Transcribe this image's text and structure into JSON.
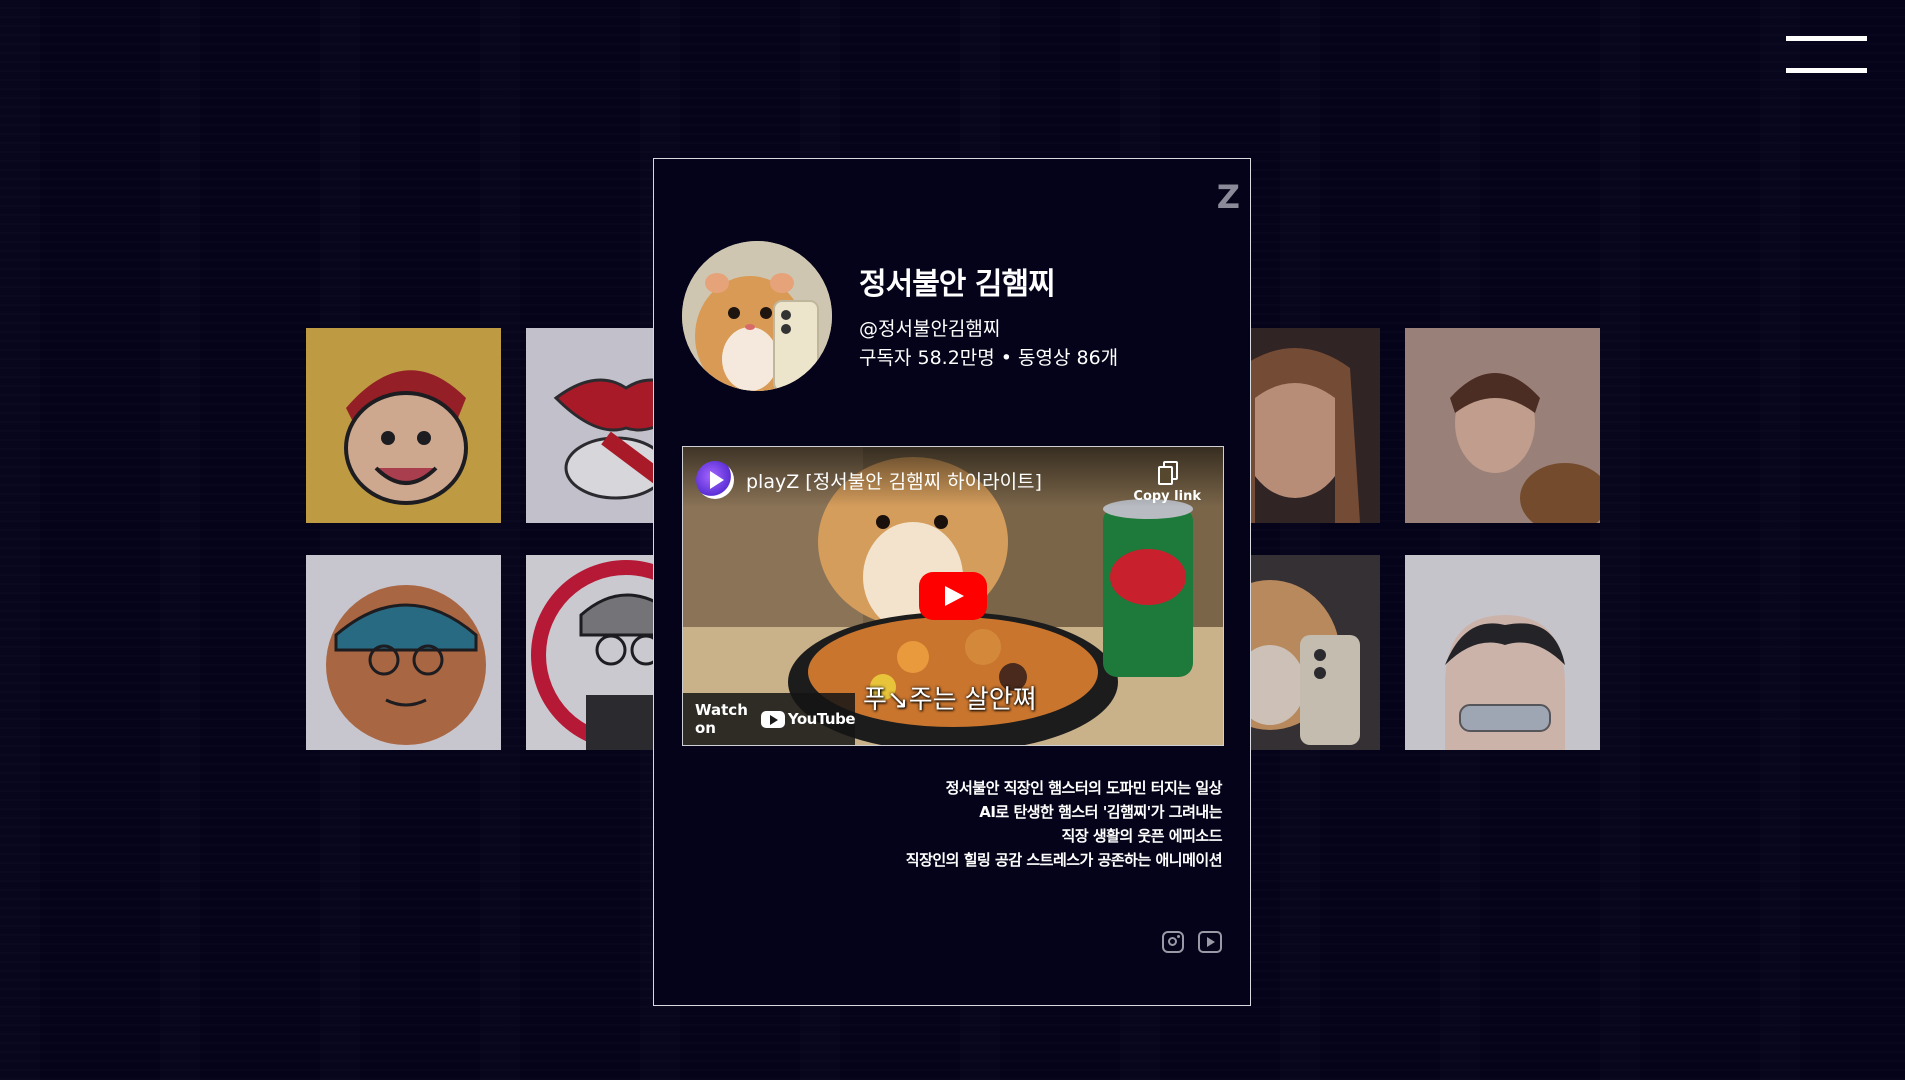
{
  "colors": {
    "background": "#04031a",
    "accent": "#ff0000",
    "text": "#ffffff",
    "muted": "#9a9aa6"
  },
  "menu": {
    "icon": "hamburger-icon"
  },
  "modal": {
    "close_label": "Z",
    "channel": {
      "name": "정서불안 김햄찌",
      "handle": "@정서불안김햄찌",
      "stats": "구독자 58.2만명 • 동영상 86개"
    },
    "video": {
      "title": "playZ [정서불안 김햄찌 하이라이트]",
      "copy_link": "Copy link",
      "caption": "푸↘주는 살안쪄",
      "watch_on": "Watch on",
      "youtube_word": "YouTube"
    },
    "description": [
      "정서불안 직장인 햄스터의 도파민 터지는 일상",
      "AI로 탄생한 햄스터 '김햄찌'가 그려내는",
      "직장 생활의 웃픈 에피소드",
      "직장인의 힐링 공감 스트레스가 공존하는 애니메이션"
    ],
    "social": [
      "instagram-icon",
      "youtube-icon"
    ]
  },
  "grid_tiles": [
    "cartoon-cap-boy",
    "lips-logo",
    "smiling-woman",
    "woman-with-dog",
    "bandana-man",
    "glasses-cartoon",
    "hamster-phone",
    "glasses-man"
  ]
}
